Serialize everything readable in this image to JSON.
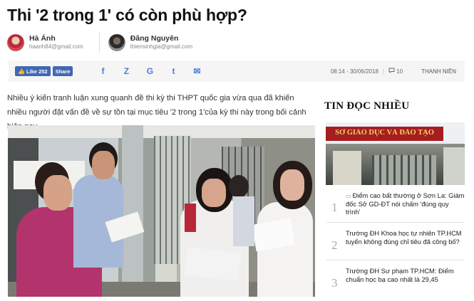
{
  "article": {
    "title": "Thi '2 trong 1' có còn phù hợp?",
    "lead": "Nhiều ý kiến tranh luận xung quanh đề thi kỳ thi THPT quốc gia vừa qua đã khiến nhiều người đặt vấn đề về sự tồn tại mục tiêu '2 trong 1'của kỳ thi này trong bối cảnh hiện nay."
  },
  "authors": [
    {
      "name": "Hà Ánh",
      "email": "haanh84@gmail.com"
    },
    {
      "name": "Đăng Nguyên",
      "email": "thiensinhgia@gmail.com"
    }
  ],
  "share": {
    "like_label": "Like",
    "like_count": "252",
    "share_label": "Share",
    "icons": [
      "facebook-icon",
      "zalo-icon",
      "google-plus-icon",
      "twitter-icon",
      "email-icon"
    ],
    "icon_glyphs": [
      "f",
      "Z",
      "G",
      "t",
      "✉"
    ]
  },
  "meta": {
    "datetime": "08:14 - 30/06/2018",
    "comment_count": "10",
    "source": "THANH NIÊN",
    "comment_icon": "comment-icon"
  },
  "sidebar": {
    "title": "TIN ĐỌC NHIỀU",
    "image_sign": "SỞ GIÁO DỤC VÀ ĐÀO TẠO",
    "items": [
      {
        "num": "1",
        "text": "Điểm cao bất thường ở Sơn La: Giám đốc Sở GD-ĐT nói chấm 'đúng quy trình'",
        "has_video": true
      },
      {
        "num": "2",
        "text": "Trường ĐH Khoa học tự nhiên TP.HCM tuyển không đúng chỉ tiêu đã công bố?",
        "has_video": false
      },
      {
        "num": "3",
        "text": "Trường ĐH Sư phạm TP.HCM: Điểm chuẩn học bạ cao nhất là 29,45",
        "has_video": false
      }
    ]
  },
  "colors": {
    "facebook": "#4267b2",
    "social_icon": "#4a7fd4",
    "sharebar_bg": "#f5f5f5"
  }
}
